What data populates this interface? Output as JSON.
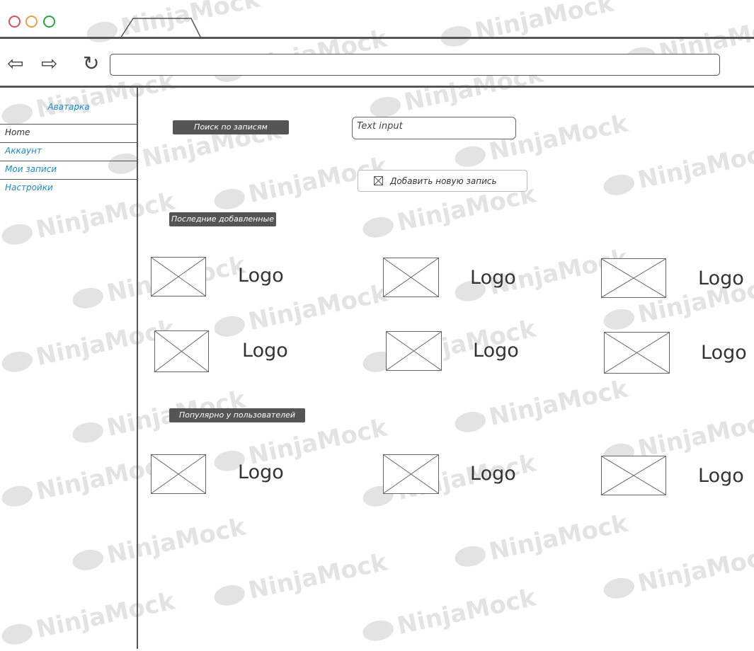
{
  "watermark": "NinjaMock",
  "window": {
    "traffic_lights": [
      "close-icon",
      "minimize-icon",
      "maximize-icon"
    ],
    "colors": {
      "close": "#d9534f",
      "minimize": "#e8a23c",
      "maximize": "#2aa745"
    }
  },
  "toolbar": {
    "back_icon": "⇦",
    "forward_icon": "⇨",
    "reload_icon": "↻",
    "address_value": ""
  },
  "sidebar": {
    "title": "Аватарка",
    "items": [
      {
        "label": "Home"
      },
      {
        "label": "Аккаунт"
      },
      {
        "label": "Мои записи"
      },
      {
        "label": "Настройки"
      }
    ],
    "accent": "#1e88c8"
  },
  "main": {
    "search_tag": "Поиск по записям",
    "search_input_value": "Text input",
    "add_button_label": "Добавить новую запись",
    "recent_tag": "Последние добавленные",
    "popular_tag": "Популярно у пользователей",
    "logo_label": "Logo",
    "recent_items": [
      {
        "label": "Logo"
      },
      {
        "label": "Logo"
      },
      {
        "label": "Logo"
      },
      {
        "label": "Logo"
      },
      {
        "label": "Logo"
      },
      {
        "label": "Logo"
      }
    ],
    "popular_items": [
      {
        "label": "Logo"
      },
      {
        "label": "Logo"
      },
      {
        "label": "Logo"
      }
    ]
  }
}
